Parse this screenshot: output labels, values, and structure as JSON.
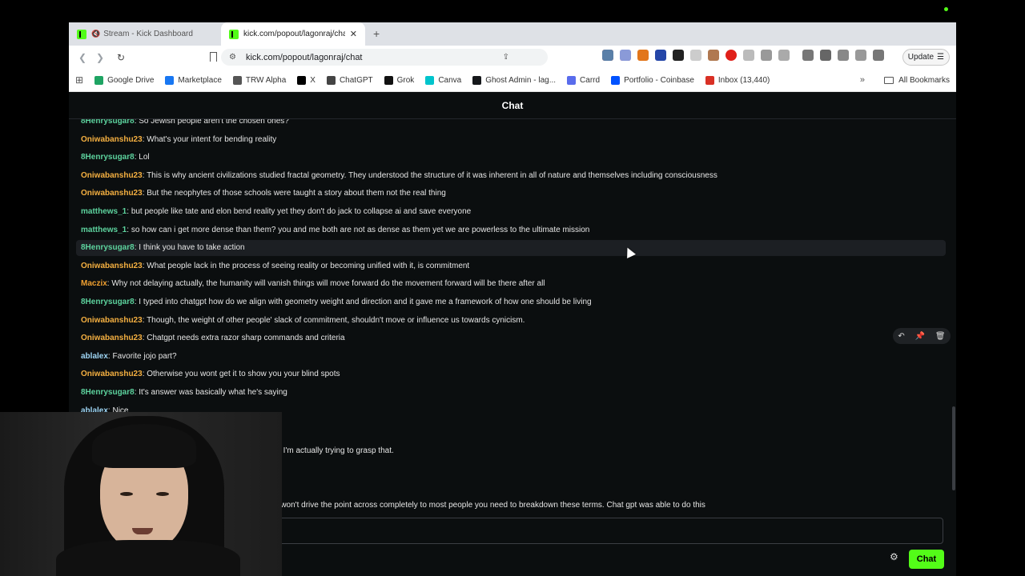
{
  "browser": {
    "tabs": [
      {
        "label": "Stream - Kick Dashboard",
        "active": false,
        "muted": true
      },
      {
        "label": "kick.com/popout/lagonraj/chat",
        "active": true
      }
    ],
    "url": "kick.com/popout/lagonraj/chat",
    "update_label": "Update",
    "bookmarks": [
      {
        "label": "Google Drive",
        "color": "#1fa463"
      },
      {
        "label": "Marketplace",
        "color": "#1877f2"
      },
      {
        "label": "TRW Alpha",
        "color": "#555555"
      },
      {
        "label": "X",
        "color": "#000000"
      },
      {
        "label": "ChatGPT",
        "color": "#444444"
      },
      {
        "label": "Grok",
        "color": "#111111"
      },
      {
        "label": "Canva",
        "color": "#00c4cc"
      },
      {
        "label": "Ghost Admin - lag...",
        "color": "#15171a"
      },
      {
        "label": "Carrd",
        "color": "#596cec"
      },
      {
        "label": "Portfolio - Coinbase",
        "color": "#0052ff"
      },
      {
        "label": "Inbox (13,440)",
        "color": "#d93025"
      }
    ],
    "all_bookmarks": "All Bookmarks"
  },
  "chat": {
    "title": "Chat",
    "messages": [
      {
        "user": "8Henrysugar8",
        "color": "#5dd39e",
        "text": "So Jewish people aren't the chosen ones?"
      },
      {
        "user": "Oniwabanshu23",
        "color": "#f5b041",
        "text": "What's your intent for bending reality"
      },
      {
        "user": "8Henrysugar8",
        "color": "#5dd39e",
        "text": "Lol"
      },
      {
        "user": "Oniwabanshu23",
        "color": "#f5b041",
        "text": "This is why ancient civilizations studied fractal geometry. They understood the structure of it was inherent in all of nature and themselves including consciousness"
      },
      {
        "user": "Oniwabanshu23",
        "color": "#f5b041",
        "text": "But the neophytes of those schools were taught a story about them not the real thing"
      },
      {
        "user": "matthews_1",
        "color": "#5dd39e",
        "text": "but people like tate and elon bend reality yet they don't do jack to collapse ai and save everyone"
      },
      {
        "user": "matthews_1",
        "color": "#5dd39e",
        "text": "so how can i get more dense than them? you and me both are not as dense as them yet we are powerless to the ultimate mission"
      },
      {
        "user": "8Henrysugar8",
        "color": "#5dd39e",
        "text": "I think you have to take action"
      },
      {
        "user": "Oniwabanshu23",
        "color": "#f5b041",
        "text": "What people lack in the process of seeing reality or becoming unified with it, is commitment"
      },
      {
        "user": "Maczix",
        "color": "#f0a030",
        "text": "Why not delaying actually, the humanity will vanish things will move forward do the movement forward will be there after all"
      },
      {
        "user": "8Henrysugar8",
        "color": "#5dd39e",
        "text": "I typed into chatgpt how do we align with geometry weight and direction and it gave me a framework of how one should be living"
      },
      {
        "user": "Oniwabanshu23",
        "color": "#f5b041",
        "text": "Though, the weight of other people' slack of commitment, shouldn't move or influence us towards cynicism."
      },
      {
        "user": "Oniwabanshu23",
        "color": "#f5b041",
        "text": "Chatgpt needs extra razor sharp commands and criteria"
      },
      {
        "user": "ablalex",
        "color": "#9fd6f5",
        "text": "Favorite jojo part?"
      },
      {
        "user": "Oniwabanshu23",
        "color": "#f5b041",
        "text": "Otherwise you wont get it to show you your blind spots"
      },
      {
        "user": "8Henrysugar8",
        "color": "#5dd39e",
        "text": "It's answer was basically what he's saying"
      },
      {
        "user": "ablalex",
        "color": "#9fd6f5",
        "text": "Nice"
      }
    ],
    "partial_lines": [
      "ef? I'm actually trying to grasp that.",
      "ns won't drive the point across completely to most people you need to breakdown these terms. Chat gpt was able to do this"
    ],
    "send_label": "Chat"
  }
}
